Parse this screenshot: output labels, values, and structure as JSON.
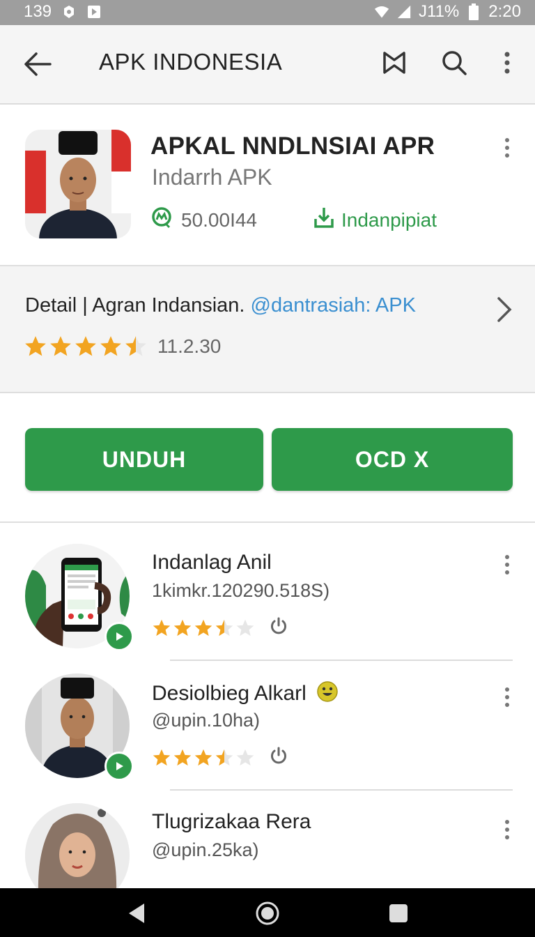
{
  "status_bar": {
    "left_text": "139",
    "battery_text": "J11%",
    "time": "2:20"
  },
  "app_bar": {
    "title": "APK INDONESIA",
    "icons": [
      "back-arrow-icon",
      "bookmark-icon",
      "search-icon",
      "more-vert-icon"
    ]
  },
  "header": {
    "app_name": "APKAL NNDLNSIAI APR",
    "developer": "Indarrh APK",
    "downloads": "50.00I44",
    "category": "Indanpipiat"
  },
  "detail": {
    "text": "Detail | Agran Indansian.",
    "link": "@dantrasiah: APK",
    "rating_count": "11.2.30",
    "rating": 4.5
  },
  "buttons": {
    "download": "UNDUH",
    "second": "OCD X"
  },
  "list": [
    {
      "name": "Indanlag Anil",
      "sub": "1kimkr.120290.518S)",
      "rating": 3.5
    },
    {
      "name": "Desiolbieg Alkarl",
      "sub": "@upin.10ha)",
      "rating": 3.5
    },
    {
      "name": "Tlugrizakaa Rera",
      "sub": "@upin.25ka)",
      "rating": 0
    }
  ],
  "colors": {
    "accent": "#2e9a4a",
    "link": "#3a8fd0",
    "star": "#f2a421"
  }
}
